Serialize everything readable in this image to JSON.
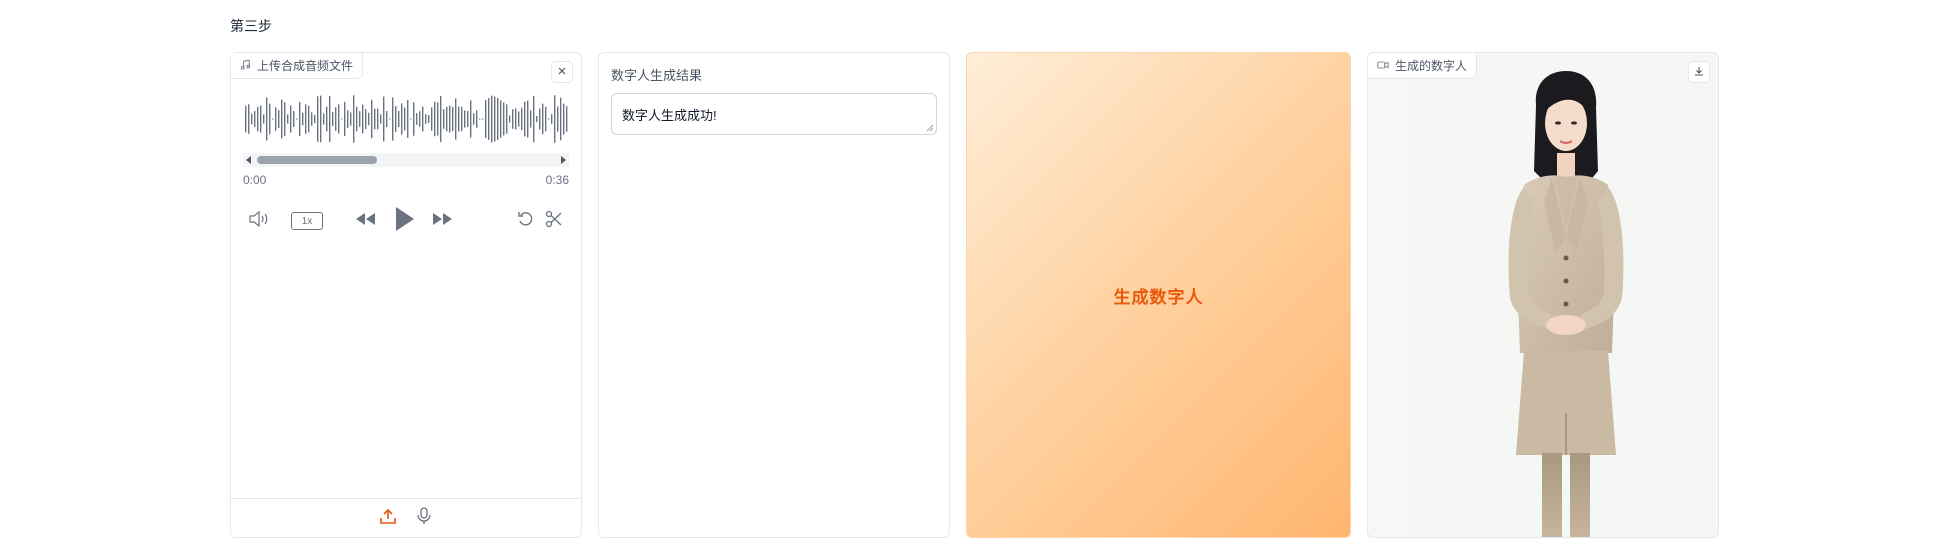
{
  "step": {
    "title": "第三步"
  },
  "audio": {
    "label": "上传合成音频文件",
    "time_current": "0:00",
    "time_total": "0:36",
    "playback_speed": "1x",
    "scroll_position": 0.4
  },
  "result": {
    "label": "数字人生成结果",
    "message": "数字人生成成功!"
  },
  "generate": {
    "label": "生成数字人"
  },
  "video": {
    "label": "生成的数字人"
  },
  "colors": {
    "accent": "#ea580c",
    "border": "#e5e7eb",
    "icon": "#6b7280",
    "button_gradient_start": "#ffeed9",
    "button_gradient_end": "#ffb56f"
  }
}
